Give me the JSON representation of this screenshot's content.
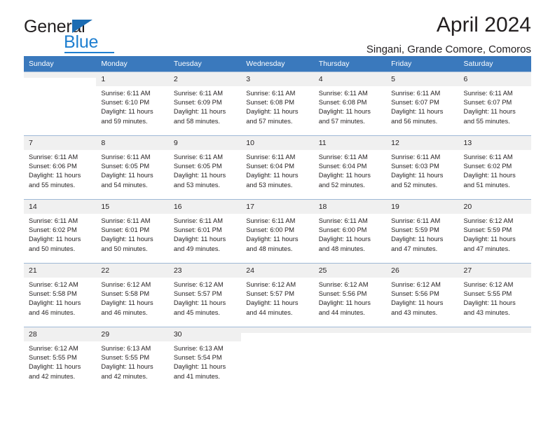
{
  "logo": {
    "word1": "General",
    "word2": "Blue",
    "triangle_color": "#1b6cb3",
    "blue_color": "#1f7fd0"
  },
  "header": {
    "title": "April 2024",
    "subtitle": "Singani, Grande Comore, Comoros"
  },
  "theme": {
    "header_band": "#3a79bd",
    "daynum_bg": "#f0f0f0",
    "row_border": "#9fb9d6",
    "text": "#231f20"
  },
  "weekday_headers": [
    "Sunday",
    "Monday",
    "Tuesday",
    "Wednesday",
    "Thursday",
    "Friday",
    "Saturday"
  ],
  "labels": {
    "sunrise_prefix": "Sunrise: ",
    "sunset_prefix": "Sunset: ",
    "daylight_prefix": "Daylight: "
  },
  "weeks": [
    [
      {
        "day": "",
        "sunrise": "",
        "sunset": "",
        "daylight1": "",
        "daylight2": "",
        "empty": true
      },
      {
        "day": "1",
        "sunrise": "Sunrise: 6:11 AM",
        "sunset": "Sunset: 6:10 PM",
        "daylight1": "Daylight: 11 hours",
        "daylight2": "and 59 minutes."
      },
      {
        "day": "2",
        "sunrise": "Sunrise: 6:11 AM",
        "sunset": "Sunset: 6:09 PM",
        "daylight1": "Daylight: 11 hours",
        "daylight2": "and 58 minutes."
      },
      {
        "day": "3",
        "sunrise": "Sunrise: 6:11 AM",
        "sunset": "Sunset: 6:08 PM",
        "daylight1": "Daylight: 11 hours",
        "daylight2": "and 57 minutes."
      },
      {
        "day": "4",
        "sunrise": "Sunrise: 6:11 AM",
        "sunset": "Sunset: 6:08 PM",
        "daylight1": "Daylight: 11 hours",
        "daylight2": "and 57 minutes."
      },
      {
        "day": "5",
        "sunrise": "Sunrise: 6:11 AM",
        "sunset": "Sunset: 6:07 PM",
        "daylight1": "Daylight: 11 hours",
        "daylight2": "and 56 minutes."
      },
      {
        "day": "6",
        "sunrise": "Sunrise: 6:11 AM",
        "sunset": "Sunset: 6:07 PM",
        "daylight1": "Daylight: 11 hours",
        "daylight2": "and 55 minutes."
      }
    ],
    [
      {
        "day": "7",
        "sunrise": "Sunrise: 6:11 AM",
        "sunset": "Sunset: 6:06 PM",
        "daylight1": "Daylight: 11 hours",
        "daylight2": "and 55 minutes."
      },
      {
        "day": "8",
        "sunrise": "Sunrise: 6:11 AM",
        "sunset": "Sunset: 6:05 PM",
        "daylight1": "Daylight: 11 hours",
        "daylight2": "and 54 minutes."
      },
      {
        "day": "9",
        "sunrise": "Sunrise: 6:11 AM",
        "sunset": "Sunset: 6:05 PM",
        "daylight1": "Daylight: 11 hours",
        "daylight2": "and 53 minutes."
      },
      {
        "day": "10",
        "sunrise": "Sunrise: 6:11 AM",
        "sunset": "Sunset: 6:04 PM",
        "daylight1": "Daylight: 11 hours",
        "daylight2": "and 53 minutes."
      },
      {
        "day": "11",
        "sunrise": "Sunrise: 6:11 AM",
        "sunset": "Sunset: 6:04 PM",
        "daylight1": "Daylight: 11 hours",
        "daylight2": "and 52 minutes."
      },
      {
        "day": "12",
        "sunrise": "Sunrise: 6:11 AM",
        "sunset": "Sunset: 6:03 PM",
        "daylight1": "Daylight: 11 hours",
        "daylight2": "and 52 minutes."
      },
      {
        "day": "13",
        "sunrise": "Sunrise: 6:11 AM",
        "sunset": "Sunset: 6:02 PM",
        "daylight1": "Daylight: 11 hours",
        "daylight2": "and 51 minutes."
      }
    ],
    [
      {
        "day": "14",
        "sunrise": "Sunrise: 6:11 AM",
        "sunset": "Sunset: 6:02 PM",
        "daylight1": "Daylight: 11 hours",
        "daylight2": "and 50 minutes."
      },
      {
        "day": "15",
        "sunrise": "Sunrise: 6:11 AM",
        "sunset": "Sunset: 6:01 PM",
        "daylight1": "Daylight: 11 hours",
        "daylight2": "and 50 minutes."
      },
      {
        "day": "16",
        "sunrise": "Sunrise: 6:11 AM",
        "sunset": "Sunset: 6:01 PM",
        "daylight1": "Daylight: 11 hours",
        "daylight2": "and 49 minutes."
      },
      {
        "day": "17",
        "sunrise": "Sunrise: 6:11 AM",
        "sunset": "Sunset: 6:00 PM",
        "daylight1": "Daylight: 11 hours",
        "daylight2": "and 48 minutes."
      },
      {
        "day": "18",
        "sunrise": "Sunrise: 6:11 AM",
        "sunset": "Sunset: 6:00 PM",
        "daylight1": "Daylight: 11 hours",
        "daylight2": "and 48 minutes."
      },
      {
        "day": "19",
        "sunrise": "Sunrise: 6:11 AM",
        "sunset": "Sunset: 5:59 PM",
        "daylight1": "Daylight: 11 hours",
        "daylight2": "and 47 minutes."
      },
      {
        "day": "20",
        "sunrise": "Sunrise: 6:12 AM",
        "sunset": "Sunset: 5:59 PM",
        "daylight1": "Daylight: 11 hours",
        "daylight2": "and 47 minutes."
      }
    ],
    [
      {
        "day": "21",
        "sunrise": "Sunrise: 6:12 AM",
        "sunset": "Sunset: 5:58 PM",
        "daylight1": "Daylight: 11 hours",
        "daylight2": "and 46 minutes."
      },
      {
        "day": "22",
        "sunrise": "Sunrise: 6:12 AM",
        "sunset": "Sunset: 5:58 PM",
        "daylight1": "Daylight: 11 hours",
        "daylight2": "and 46 minutes."
      },
      {
        "day": "23",
        "sunrise": "Sunrise: 6:12 AM",
        "sunset": "Sunset: 5:57 PM",
        "daylight1": "Daylight: 11 hours",
        "daylight2": "and 45 minutes."
      },
      {
        "day": "24",
        "sunrise": "Sunrise: 6:12 AM",
        "sunset": "Sunset: 5:57 PM",
        "daylight1": "Daylight: 11 hours",
        "daylight2": "and 44 minutes."
      },
      {
        "day": "25",
        "sunrise": "Sunrise: 6:12 AM",
        "sunset": "Sunset: 5:56 PM",
        "daylight1": "Daylight: 11 hours",
        "daylight2": "and 44 minutes."
      },
      {
        "day": "26",
        "sunrise": "Sunrise: 6:12 AM",
        "sunset": "Sunset: 5:56 PM",
        "daylight1": "Daylight: 11 hours",
        "daylight2": "and 43 minutes."
      },
      {
        "day": "27",
        "sunrise": "Sunrise: 6:12 AM",
        "sunset": "Sunset: 5:55 PM",
        "daylight1": "Daylight: 11 hours",
        "daylight2": "and 43 minutes."
      }
    ],
    [
      {
        "day": "28",
        "sunrise": "Sunrise: 6:12 AM",
        "sunset": "Sunset: 5:55 PM",
        "daylight1": "Daylight: 11 hours",
        "daylight2": "and 42 minutes."
      },
      {
        "day": "29",
        "sunrise": "Sunrise: 6:13 AM",
        "sunset": "Sunset: 5:55 PM",
        "daylight1": "Daylight: 11 hours",
        "daylight2": "and 42 minutes."
      },
      {
        "day": "30",
        "sunrise": "Sunrise: 6:13 AM",
        "sunset": "Sunset: 5:54 PM",
        "daylight1": "Daylight: 11 hours",
        "daylight2": "and 41 minutes."
      },
      {
        "day": "",
        "sunrise": "",
        "sunset": "",
        "daylight1": "",
        "daylight2": "",
        "empty": true
      },
      {
        "day": "",
        "sunrise": "",
        "sunset": "",
        "daylight1": "",
        "daylight2": "",
        "empty": true
      },
      {
        "day": "",
        "sunrise": "",
        "sunset": "",
        "daylight1": "",
        "daylight2": "",
        "empty": true
      },
      {
        "day": "",
        "sunrise": "",
        "sunset": "",
        "daylight1": "",
        "daylight2": "",
        "empty": true
      }
    ]
  ]
}
